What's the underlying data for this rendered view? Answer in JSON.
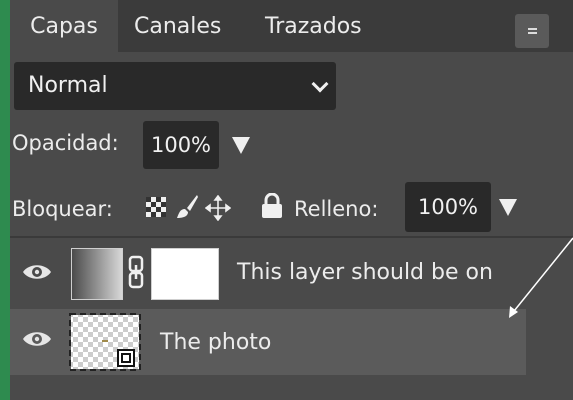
{
  "tabs": [
    {
      "label": "Capas",
      "active": true
    },
    {
      "label": "Canales",
      "active": false
    },
    {
      "label": "Trazados",
      "active": false
    }
  ],
  "panel_menu_icon": "hamburger-icon",
  "blend_mode": {
    "selected": "Normal"
  },
  "opacity": {
    "label": "Opacidad:",
    "value": "100%"
  },
  "lock": {
    "label": "Bloquear:",
    "icons": [
      "lock-transparency-icon",
      "lock-paint-icon",
      "lock-position-icon",
      "lock-all-icon"
    ]
  },
  "fill": {
    "label": "Relleno:",
    "value": "100%"
  },
  "layers": [
    {
      "name": "This layer should be on",
      "visible": true,
      "thumbnail": "gradient",
      "mask": true,
      "linked": true,
      "selected": false
    },
    {
      "name": "The photo",
      "visible": true,
      "thumbnail": "transparent",
      "mask": false,
      "linked": false,
      "selected": true
    }
  ],
  "colors": {
    "accent_border": "#2e8b4f",
    "panel": "#4a4a4a",
    "field": "#292929"
  }
}
